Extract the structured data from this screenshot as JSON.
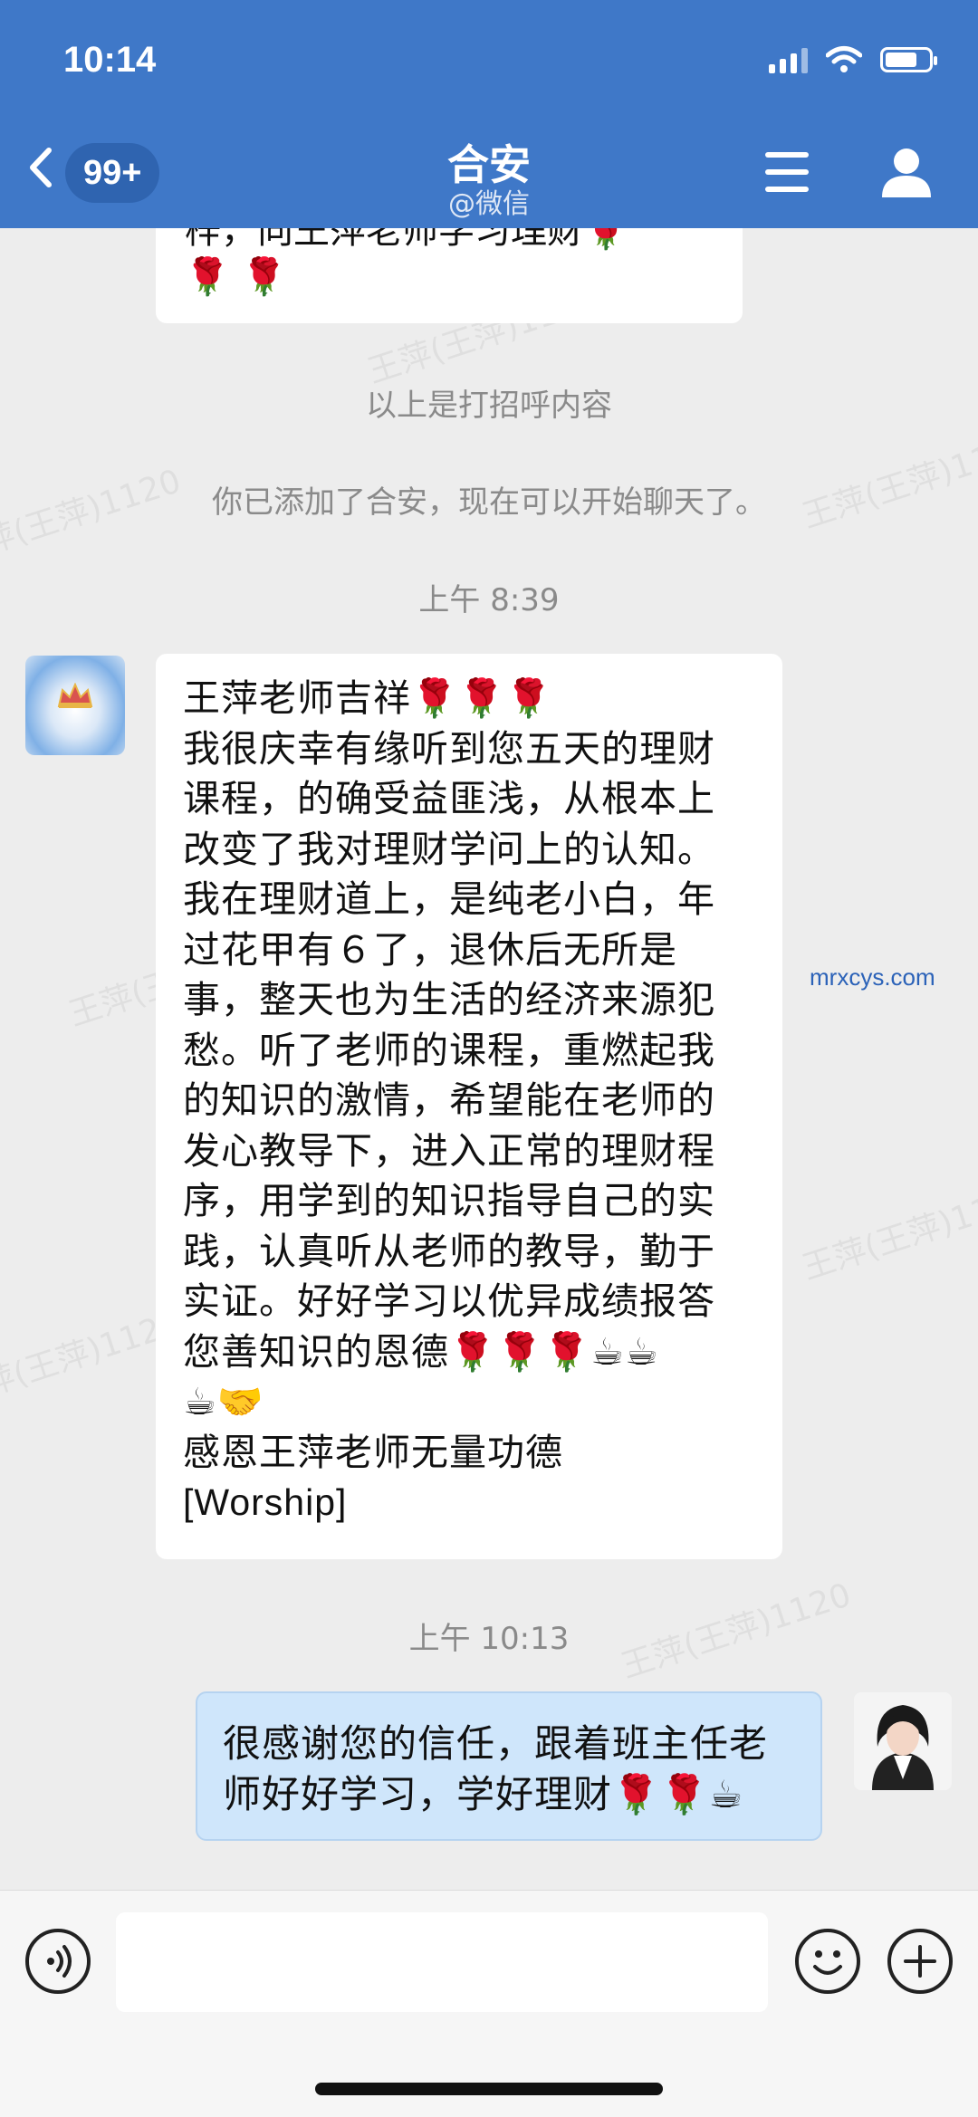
{
  "status_bar": {
    "time": "10:14"
  },
  "header": {
    "unread_badge": "99+",
    "title": "合安",
    "subtitle": "@微信"
  },
  "chat": {
    "prev_message_fragment": "梓，向王萍老师学习理财🌹",
    "prev_message_emoji": "🌹 🌹",
    "system_greeting": "以上是打招呼内容",
    "system_added": "你已添加了合安，现在可以开始聊天了。",
    "time_1": "上午 8:39",
    "incoming_message": {
      "lines": [
        "王萍老师吉祥🌹🌹🌹",
        "我很庆幸有缘听到您五天的理财",
        "课程，的确受益匪浅，从根本上",
        "改变了我对理财学问上的认知。",
        "我在理财道上，是纯老小白，年",
        "过花甲有６了，退休后无所是",
        "事，整天也为生活的经济来源犯",
        "愁。听了老师的课程，重燃起我",
        "的知识的激情，希望能在老师的",
        "发心教导下，进入正常的理财程",
        "序，用学到的知识指导自己的实",
        "践，认真听从老师的教导，勤于",
        "实证。好好学习以优异成绩报答",
        "您善知识的恩德🌹🌹🌹☕☕",
        "☕🤝",
        "感恩王萍老师无量功德",
        "[Worship]"
      ]
    },
    "time_2": "上午 10:13",
    "outgoing_message": {
      "lines": [
        "很感谢您的信任，跟着班主任老",
        "师好好学习，学好理财🌹🌹☕"
      ]
    },
    "side_link": "mrxcys.com",
    "watermark": "王萍(王萍)1120"
  },
  "icons": {
    "back": "chevron-left-icon",
    "menu": "menu-icon",
    "profile": "person-icon",
    "voice": "voice-icon",
    "emoji": "emoji-icon",
    "add": "plus-icon"
  },
  "colors": {
    "header": "#3f78c8",
    "badge": "#2f64b0",
    "outgoing_bubble": "#cfe6fb",
    "chat_bg": "#ededed"
  }
}
